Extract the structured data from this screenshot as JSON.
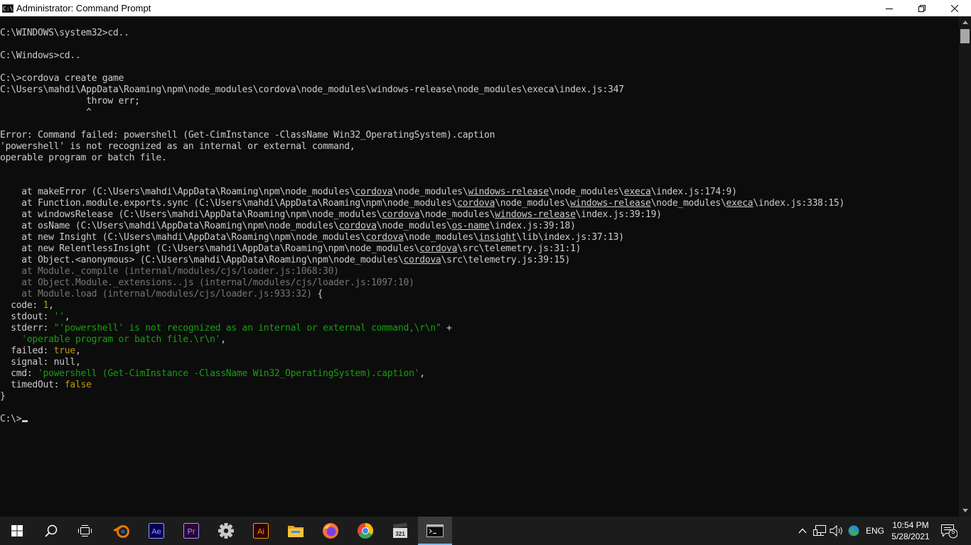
{
  "window": {
    "title": "Administrator: Command Prompt",
    "icon_text": "C:\\"
  },
  "console": {
    "lines": [
      [
        {
          "t": "C:\\WINDOWS\\system32>cd.."
        }
      ],
      [
        {
          "t": ""
        }
      ],
      [
        {
          "t": "C:\\Windows>cd.."
        }
      ],
      [
        {
          "t": ""
        }
      ],
      [
        {
          "t": "C:\\>cordova create game"
        }
      ],
      [
        {
          "t": "C:\\Users\\mahdi\\AppData\\Roaming\\npm\\node_modules\\cordova\\node_modules\\windows-release\\node_modules\\execa\\index.js:347"
        }
      ],
      [
        {
          "t": "                throw err;"
        }
      ],
      [
        {
          "t": "                ^"
        }
      ],
      [
        {
          "t": ""
        }
      ],
      [
        {
          "t": "Error: Command failed: powershell (Get-CimInstance -ClassName Win32_OperatingSystem).caption"
        }
      ],
      [
        {
          "t": "'powershell' is not recognized as an internal or external command,"
        }
      ],
      [
        {
          "t": "operable program or batch file."
        }
      ],
      [
        {
          "t": ""
        }
      ],
      [
        {
          "t": ""
        }
      ],
      [
        {
          "t": "    at makeError (C:\\Users\\mahdi\\AppData\\Roaming\\npm\\node_modules\\"
        },
        {
          "t": "cordova",
          "c": "u"
        },
        {
          "t": "\\node_modules\\"
        },
        {
          "t": "windows-release",
          "c": "u"
        },
        {
          "t": "\\node_modules\\"
        },
        {
          "t": "execa",
          "c": "u"
        },
        {
          "t": "\\index.js:174:9)"
        }
      ],
      [
        {
          "t": "    at Function.module.exports.sync (C:\\Users\\mahdi\\AppData\\Roaming\\npm\\node_modules\\"
        },
        {
          "t": "cordova",
          "c": "u"
        },
        {
          "t": "\\node_modules\\"
        },
        {
          "t": "windows-release",
          "c": "u"
        },
        {
          "t": "\\node_modules\\"
        },
        {
          "t": "execa",
          "c": "u"
        },
        {
          "t": "\\index.js:338:15)"
        }
      ],
      [
        {
          "t": "    at windowsRelease (C:\\Users\\mahdi\\AppData\\Roaming\\npm\\node_modules\\"
        },
        {
          "t": "cordova",
          "c": "u"
        },
        {
          "t": "\\node_modules\\"
        },
        {
          "t": "windows-release",
          "c": "u"
        },
        {
          "t": "\\index.js:39:19)"
        }
      ],
      [
        {
          "t": "    at osName (C:\\Users\\mahdi\\AppData\\Roaming\\npm\\node_modules\\"
        },
        {
          "t": "cordova",
          "c": "u"
        },
        {
          "t": "\\node_modules\\"
        },
        {
          "t": "os-name",
          "c": "u"
        },
        {
          "t": "\\index.js:39:18)"
        }
      ],
      [
        {
          "t": "    at new Insight (C:\\Users\\mahdi\\AppData\\Roaming\\npm\\node_modules\\"
        },
        {
          "t": "cordova",
          "c": "u"
        },
        {
          "t": "\\node_modules\\"
        },
        {
          "t": "insight",
          "c": "u"
        },
        {
          "t": "\\lib\\index.js:37:13)"
        }
      ],
      [
        {
          "t": "    at new RelentlessInsight (C:\\Users\\mahdi\\AppData\\Roaming\\npm\\node_modules\\"
        },
        {
          "t": "cordova",
          "c": "u"
        },
        {
          "t": "\\src\\telemetry.js:31:1)"
        }
      ],
      [
        {
          "t": "    at Object.<anonymous> (C:\\Users\\mahdi\\AppData\\Roaming\\npm\\node_modules\\"
        },
        {
          "t": "cordova",
          "c": "u"
        },
        {
          "t": "\\src\\telemetry.js:39:15)"
        }
      ],
      [
        {
          "t": "    at Module._compile (internal/modules/cjs/loader.js:1068:30)",
          "c": "dim"
        }
      ],
      [
        {
          "t": "    at Object.Module._extensions..js (internal/modules/cjs/loader.js:1097:10)",
          "c": "dim"
        }
      ],
      [
        {
          "t": "    at Module.load (internal/modules/cjs/loader.js:933:32)",
          "c": "dim"
        },
        {
          "t": " {"
        }
      ],
      [
        {
          "t": "  code: "
        },
        {
          "t": "1",
          "c": "y"
        },
        {
          "t": ","
        }
      ],
      [
        {
          "t": "  stdout: "
        },
        {
          "t": "''",
          "c": "g"
        },
        {
          "t": ","
        }
      ],
      [
        {
          "t": "  stderr: "
        },
        {
          "t": "\"'powershell' is not recognized as an internal or external command,\\r\\n\"",
          "c": "g"
        },
        {
          "t": " +"
        }
      ],
      [
        {
          "t": "    "
        },
        {
          "t": "'operable program or batch file.\\r\\n'",
          "c": "g"
        },
        {
          "t": ","
        }
      ],
      [
        {
          "t": "  failed: "
        },
        {
          "t": "true",
          "c": "y"
        },
        {
          "t": ","
        }
      ],
      [
        {
          "t": "  signal: "
        },
        {
          "t": "null"
        },
        {
          "t": ","
        }
      ],
      [
        {
          "t": "  cmd: "
        },
        {
          "t": "'powershell (Get-CimInstance -ClassName Win32_OperatingSystem).caption'",
          "c": "g"
        },
        {
          "t": ","
        }
      ],
      [
        {
          "t": "  timedOut: "
        },
        {
          "t": "false",
          "c": "y"
        }
      ],
      [
        {
          "t": "}"
        }
      ],
      [
        {
          "t": ""
        }
      ],
      [
        {
          "t": "C:\\>"
        }
      ]
    ]
  },
  "taskbar": {
    "apps": [
      {
        "name": "start-button",
        "icon": "windows-logo-icon"
      },
      {
        "name": "search-button",
        "icon": "search-icon"
      },
      {
        "name": "task-view-button",
        "icon": "task-view-icon"
      },
      {
        "name": "blender-app",
        "icon": "blender-icon",
        "color": "#ea7600"
      },
      {
        "name": "after-effects-app",
        "icon": "after-effects-icon",
        "label": "Ae",
        "color": "#9999ff",
        "bg": "#00005b"
      },
      {
        "name": "premiere-app",
        "icon": "premiere-icon",
        "label": "Pr",
        "color": "#9999ff",
        "bg": "#2a0634"
      },
      {
        "name": "settings-app",
        "icon": "gear-icon",
        "color": "#c8c8c8"
      },
      {
        "name": "illustrator-app",
        "icon": "illustrator-icon",
        "label": "Ai",
        "color": "#ff9a00",
        "bg": "#330000"
      },
      {
        "name": "file-explorer-app",
        "icon": "folder-icon",
        "color": "#f6c343"
      },
      {
        "name": "firefox-app",
        "icon": "firefox-icon",
        "color": "#ff7139"
      },
      {
        "name": "chrome-app",
        "icon": "chrome-icon",
        "color": "#4285f4"
      },
      {
        "name": "clapper-app",
        "icon": "clapperboard-icon",
        "label": "321",
        "color": "#dddddd"
      },
      {
        "name": "command-prompt-app",
        "icon": "terminal-icon",
        "active": true
      }
    ],
    "tray": {
      "language": "ENG",
      "time": "10:54 PM",
      "date": "5/28/2021",
      "notification_count": "5"
    }
  }
}
